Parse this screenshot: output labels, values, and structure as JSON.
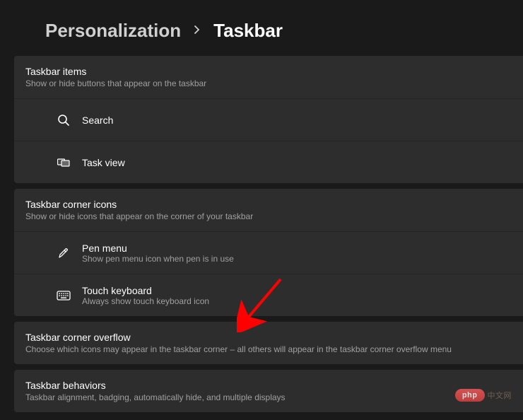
{
  "breadcrumb": {
    "parent": "Personalization",
    "current": "Taskbar"
  },
  "sections": {
    "items": {
      "title": "Taskbar items",
      "desc": "Show or hide buttons that appear on the taskbar",
      "rows": [
        {
          "icon": "search",
          "label": "Search"
        },
        {
          "icon": "taskview",
          "label": "Task view"
        }
      ]
    },
    "corner": {
      "title": "Taskbar corner icons",
      "desc": "Show or hide icons that appear on the corner of your taskbar",
      "rows": [
        {
          "icon": "pen",
          "label": "Pen menu",
          "desc": "Show pen menu icon when pen is in use"
        },
        {
          "icon": "keyboard",
          "label": "Touch keyboard",
          "desc": "Always show touch keyboard icon"
        }
      ]
    },
    "overflow": {
      "title": "Taskbar corner overflow",
      "desc": "Choose which icons may appear in the taskbar corner – all others will appear in the taskbar corner overflow menu"
    },
    "behaviors": {
      "title": "Taskbar behaviors",
      "desc": "Taskbar alignment, badging, automatically hide, and multiple displays"
    }
  },
  "watermark": {
    "badge": "php",
    "text": "中文网"
  }
}
